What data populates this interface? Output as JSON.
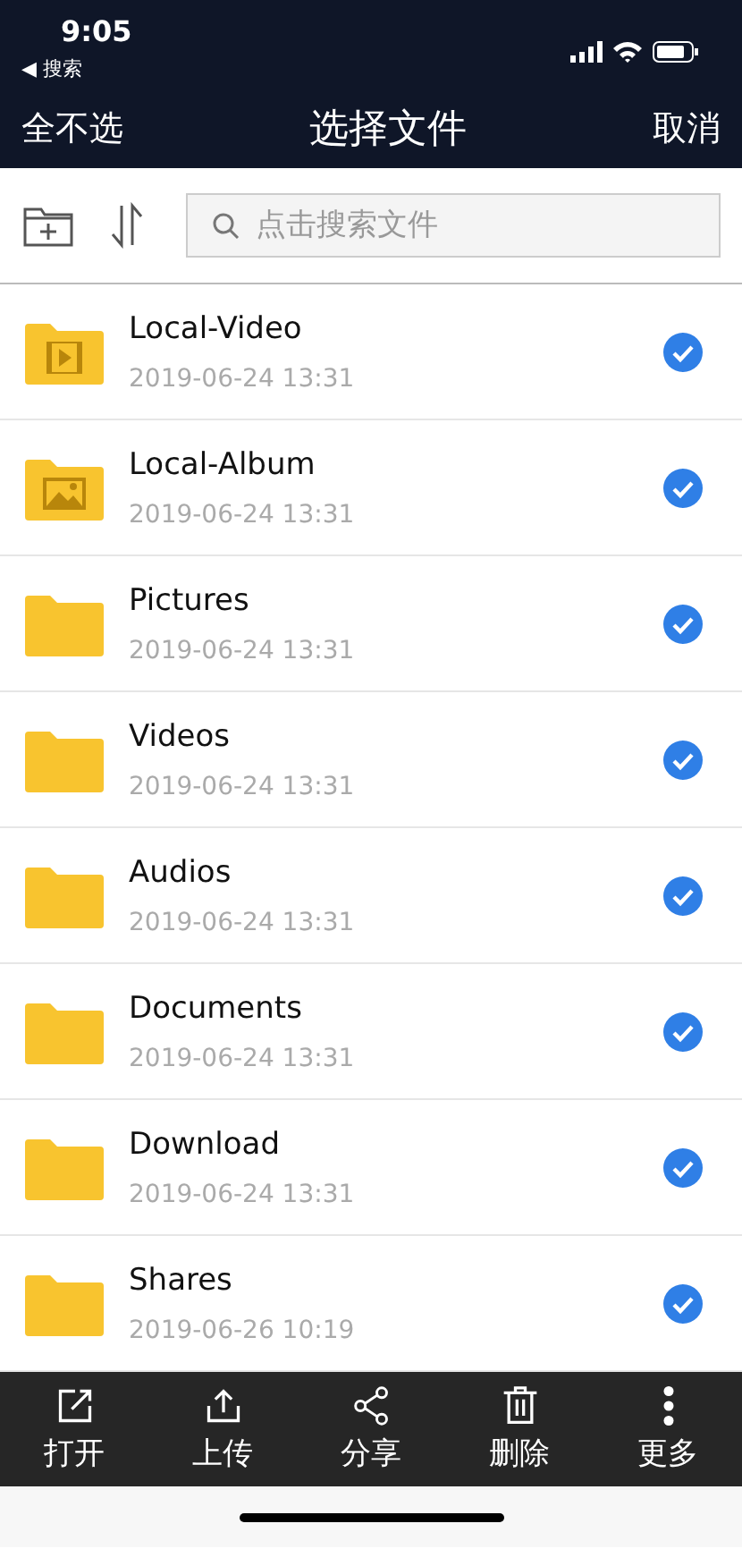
{
  "status_bar": {
    "time": "9:05",
    "back": "◀ 搜索"
  },
  "nav_bar": {
    "left": "全不选",
    "title": "选择文件",
    "right": "取消"
  },
  "search": {
    "placeholder": "点击搜索文件"
  },
  "files": [
    {
      "name": "Local-Video",
      "date": "2019-06-24 13:31",
      "kind": "video",
      "checked": true
    },
    {
      "name": "Local-Album",
      "date": "2019-06-24 13:31",
      "kind": "album",
      "checked": true
    },
    {
      "name": "Pictures",
      "date": "2019-06-24 13:31",
      "kind": "folder",
      "checked": true
    },
    {
      "name": "Videos",
      "date": "2019-06-24 13:31",
      "kind": "folder",
      "checked": true
    },
    {
      "name": "Audios",
      "date": "2019-06-24 13:31",
      "kind": "folder",
      "checked": true
    },
    {
      "name": "Documents",
      "date": "2019-06-24 13:31",
      "kind": "folder",
      "checked": true
    },
    {
      "name": "Download",
      "date": "2019-06-24 13:31",
      "kind": "folder",
      "checked": true
    },
    {
      "name": "Shares",
      "date": "2019-06-26 10:19",
      "kind": "folder",
      "checked": true
    }
  ],
  "actions": [
    {
      "label": "打开",
      "kind": "open"
    },
    {
      "label": "上传",
      "kind": "upload"
    },
    {
      "label": "分享",
      "kind": "share"
    },
    {
      "label": "删除",
      "kind": "delete"
    },
    {
      "label": "更多",
      "kind": "more"
    }
  ]
}
